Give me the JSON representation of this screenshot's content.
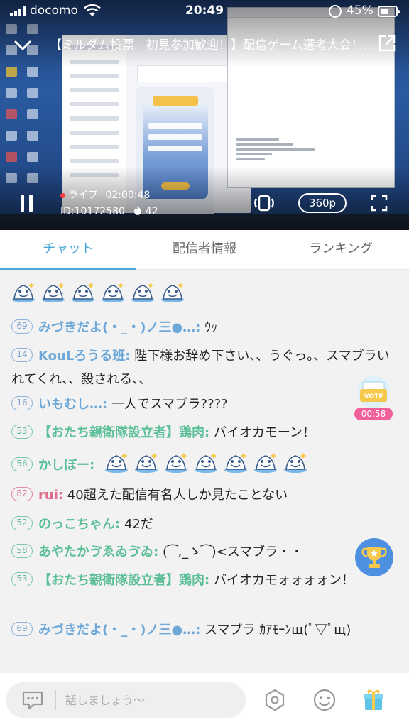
{
  "status_bar": {
    "carrier": "docomo",
    "time": "20:49",
    "battery": "45%"
  },
  "player": {
    "title": "【ミルダム投票　初見参加歓迎！】配信ゲーム選考大会！…",
    "live_label": "ライブ",
    "elapsed": "02:00:48",
    "stream_id": "ID:10172580",
    "viewers": "42",
    "quality": "360p"
  },
  "tabs": [
    {
      "label": "チャット",
      "active": true
    },
    {
      "label": "配信者情報",
      "active": false
    },
    {
      "label": "ランキング",
      "active": false
    }
  ],
  "chat": {
    "stamp_row_count": 6,
    "messages": [
      {
        "level": "69",
        "name": "みづきだよ(・_・)ノ三●…:",
        "text": "ｳｯ",
        "color": "blue"
      },
      {
        "level": "14",
        "name": "KouLろうる班:",
        "text": "陛下様お辞め下さい、、うぐっ。、スマブラいれてくれ、、殺される、、",
        "color": "blue"
      },
      {
        "level": "16",
        "name": "いもむし…:",
        "text": "一人でスマブラ????",
        "color": "blue"
      },
      {
        "level": "53",
        "name": "【おたち親衛隊設立者】鶏肉:",
        "text": "バイオカモーン！",
        "color": "green"
      },
      {
        "level": "56",
        "name": "かしぼー:",
        "text": "",
        "stamps": 7,
        "color": "green"
      },
      {
        "level": "82",
        "name": "rui:",
        "text": "40超えた配信有名人しか見たことない",
        "color": "red"
      },
      {
        "level": "52",
        "name": "のっこちゃん:",
        "text": "42だ",
        "color": "green"
      },
      {
        "level": "58",
        "name": "あやたかゔゑゐゔゐ:",
        "text": "(⁀‚_ゝ⁀)<スマブラ・・",
        "color": "green"
      },
      {
        "level": "53",
        "name": "【おたち親衛隊設立者】鶏肉:",
        "text": "バイオカモォォォォン！",
        "color": "green"
      },
      {
        "level": "69",
        "name": "みづきだよ(・_・)ノ三●…:",
        "text": "スマブラ ｶｱﾓｰﾝщ(ﾟ▽ﾟщ)",
        "color": "blue"
      }
    ]
  },
  "vote": {
    "label": "VOTE",
    "timer": "00:58"
  },
  "input": {
    "placeholder": "話しましょう～"
  },
  "colors": {
    "accent": "#4aa8d8",
    "level_blue": "#7da3cf",
    "level_green": "#5fb892",
    "level_red": "#d9708a",
    "vote_pink": "#f0609a"
  }
}
